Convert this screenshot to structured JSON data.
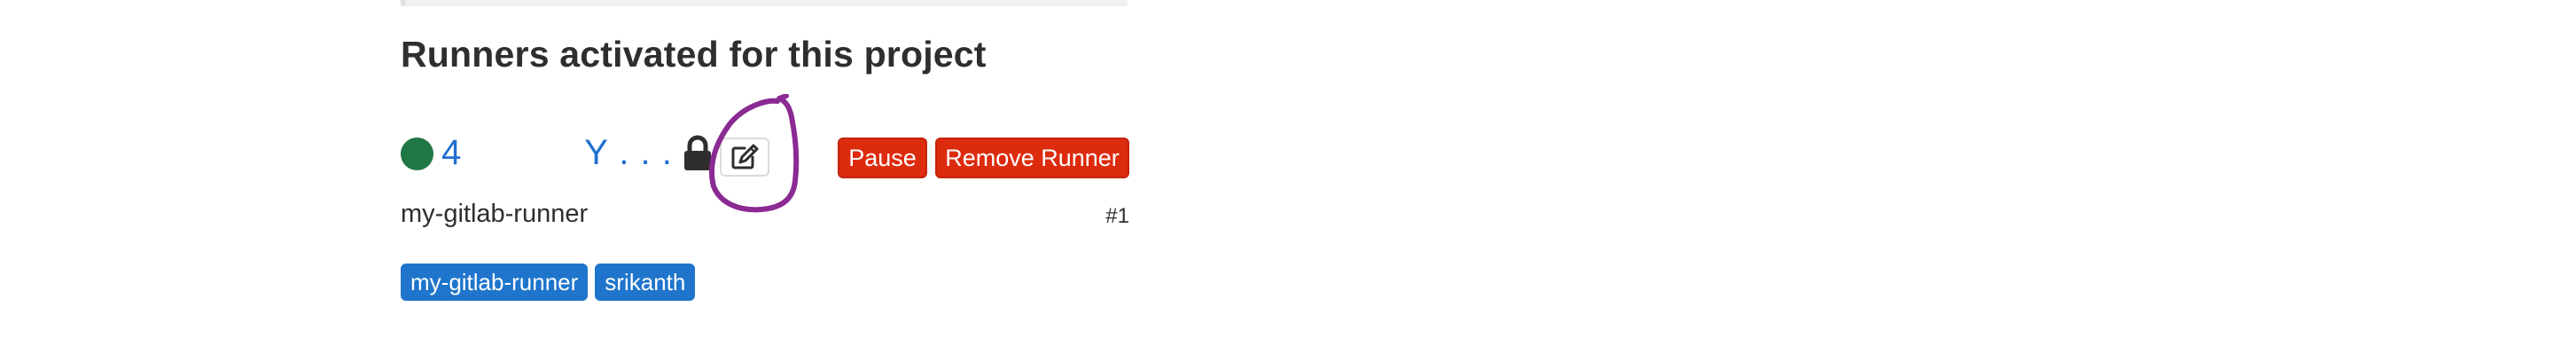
{
  "section": {
    "heading": "Runners activated for this project"
  },
  "runner": {
    "status_color": "#217645",
    "token_start": "4",
    "token_end": "Y . . .",
    "description": "my-gitlab-runner",
    "id_label": "#1",
    "locked_icon": "lock-icon",
    "edit_icon": "pencil-square-icon",
    "pause_label": "Pause",
    "remove_label": "Remove Runner",
    "tags": [
      "my-gitlab-runner",
      "srikanth"
    ]
  },
  "colors": {
    "danger": "#dd2b0e",
    "tag": "#1f75cb",
    "link": "#1f6fd2",
    "annotation": "#8b2a93"
  }
}
